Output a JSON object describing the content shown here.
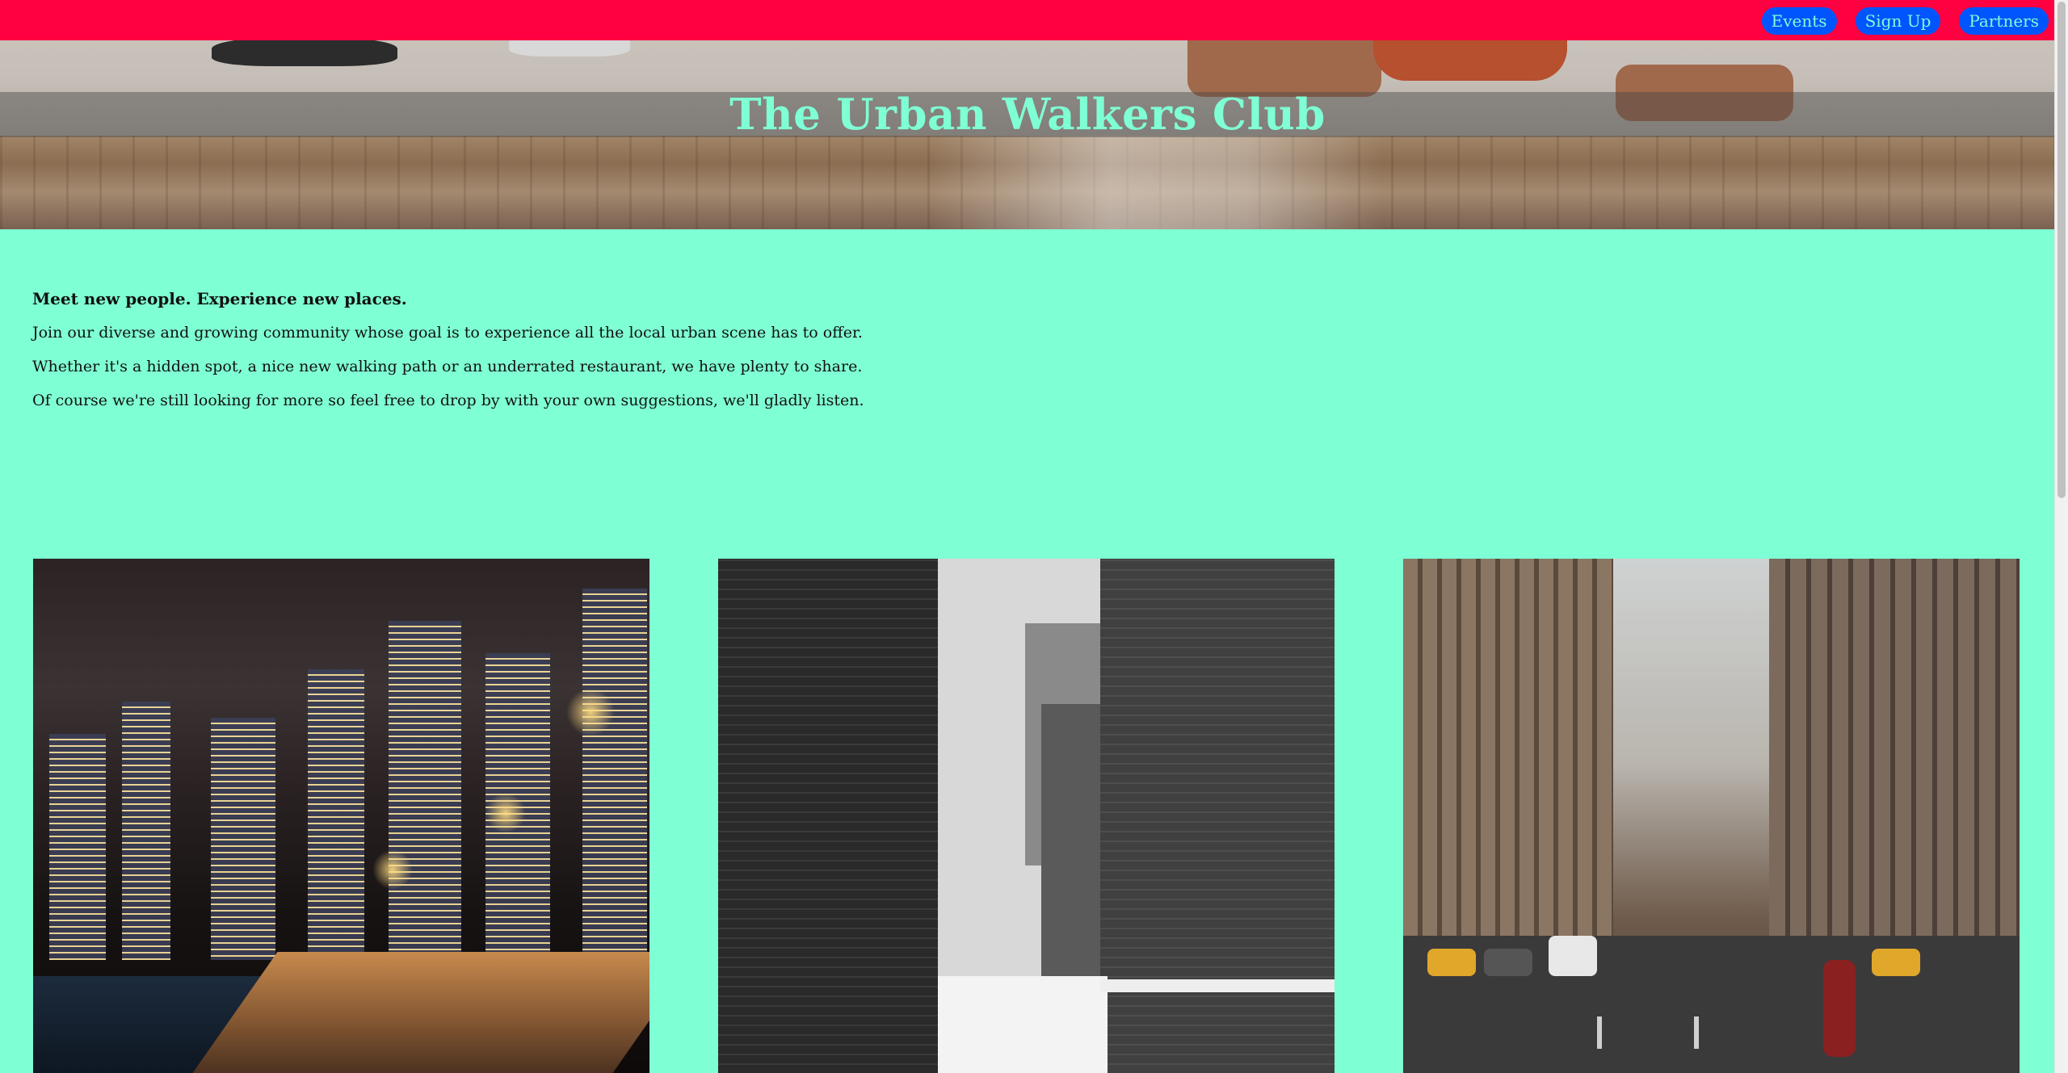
{
  "header": {
    "title": "The Urban Walkers Club",
    "nav": [
      {
        "label": "Events"
      },
      {
        "label": "Sign Up"
      },
      {
        "label": "Partners"
      }
    ]
  },
  "intro": {
    "lead": "Meet new people. Experience new places.",
    "paragraphs": [
      "Join our diverse and growing community whose goal is to experience all the local urban scene has to offer.",
      "Whether it's a hidden spot, a nice new walking path or an underrated restaurant, we have plenty to share.",
      "Of course we're still looking for more so feel free to drop by with your own suggestions, we'll gladly listen."
    ]
  },
  "gallery": [
    {
      "subject": "night-city-bridge"
    },
    {
      "subject": "snowy-alley"
    },
    {
      "subject": "city-street"
    }
  ],
  "colors": {
    "nav_bar": "#ff0040",
    "nav_button": "#0055ff",
    "accent": "#7fffd4"
  }
}
